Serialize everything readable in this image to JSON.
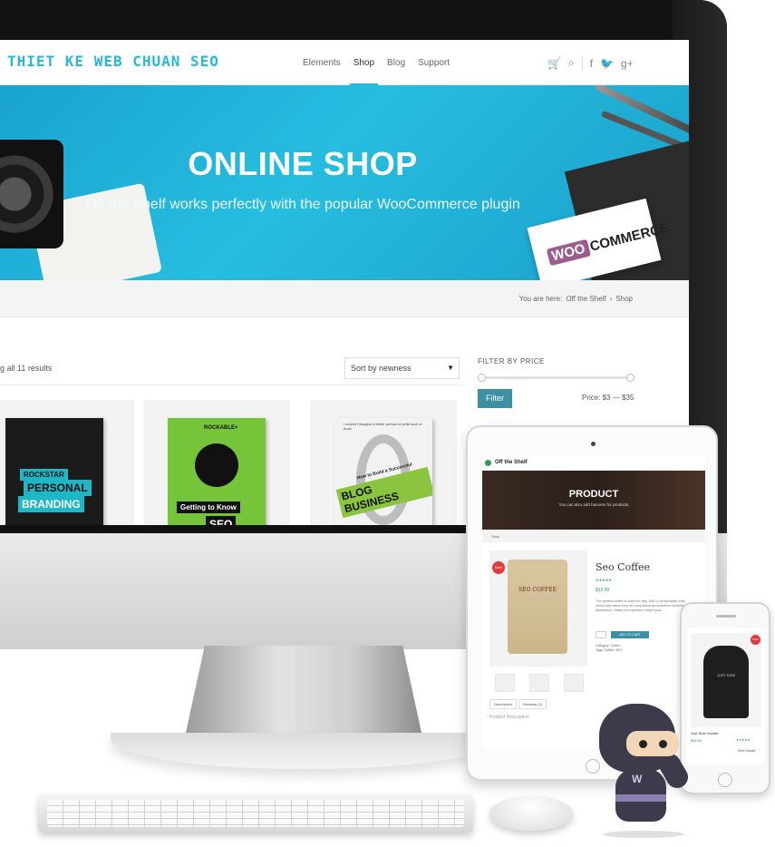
{
  "site": {
    "logo": "THIET KE WEB CHUAN SEO",
    "nav": [
      "Elements",
      "Shop",
      "Blog",
      "Support"
    ],
    "header_icons": [
      "cart-icon",
      "search-icon",
      "facebook-icon",
      "twitter-icon",
      "google-plus-icon"
    ]
  },
  "hero": {
    "title": "ONLINE SHOP",
    "subtitle": "Off the Shelf works perfectly with the popular WooCommerce plugin",
    "woo_badge": "WOO",
    "woo_text": "COMMERCE"
  },
  "breadcrumb": {
    "prefix": "You are here:",
    "items": [
      "Off the Shelf",
      "Shop"
    ],
    "separator": "›"
  },
  "shop": {
    "results": "g all 11 results",
    "sort": "Sort by newness",
    "filter_title": "FILTER BY PRICE",
    "filter_button": "Filter",
    "price_range": "Price: $3 — $35",
    "products": [
      {
        "label_a": "ROCKSTAR",
        "label_b": "PERSONAL",
        "label_c": "BRANDING"
      },
      {
        "label_a": "ROCKABLE+",
        "label_b": "Getting to Know",
        "label_c": "SEO"
      },
      {
        "label_a": "I couldn't imagine a better person to write such a book",
        "label_b": "How to Build a Successful",
        "label_c": "BLOG BUSINESS"
      }
    ]
  },
  "tablet": {
    "logo": "Off the Shelf",
    "hero_title": "PRODUCT",
    "hero_sub": "You can also add banners for products",
    "crumb": "Shop",
    "sale": "Sale!",
    "product_title": "Seo Coffee",
    "stars": "★★★★★",
    "price": "$12.99",
    "description": "The perfect coffee to start the day. Sed ut perspiciatis unde omnis iste natus error sit voluptatem accusantium doloremque laudantium, totam rem aperiam eaque ipsa.",
    "bag_label": "SEO COFFEE",
    "add_to_cart": "ADD TO CART",
    "meta_category": "Category: Coffee",
    "meta_tags": "Tags: Coffee, SEO",
    "tabs": [
      "Description",
      "Reviews (1)"
    ],
    "product_description": "Product Description"
  },
  "phone": {
    "sale": "Sale!",
    "product_name": "Just Ride Hoodie",
    "price": "$35.00",
    "stars": "★★★★★",
    "view_details": "View Details",
    "hoodie_text": "JUST RIDE"
  }
}
